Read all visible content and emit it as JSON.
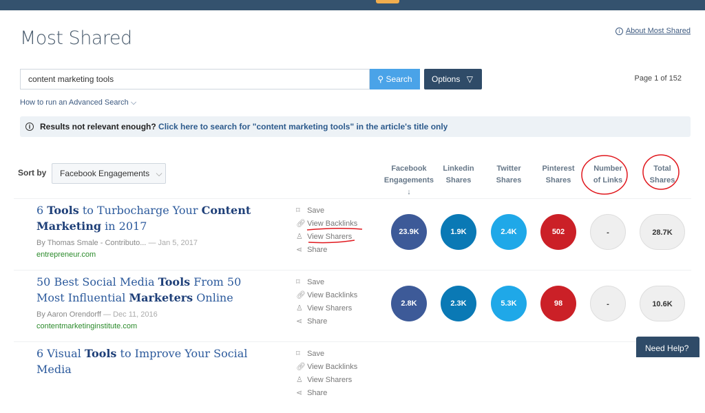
{
  "header": {
    "title": "Most Shared",
    "about_link": "About Most Shared"
  },
  "search": {
    "value": "content marketing tools",
    "button": "Search",
    "options": "Options",
    "page": "Page 1 of 152",
    "advanced": "How to run an Advanced Search"
  },
  "banner": {
    "prefix": "Results not relevant enough?",
    "link": "Click here to search for \"content marketing tools\" in the article's title only"
  },
  "sort": {
    "label": "Sort by",
    "value": "Facebook Engagements"
  },
  "columns": [
    {
      "line1": "Facebook",
      "line2": "Engagements ↓"
    },
    {
      "line1": "Linkedin",
      "line2": "Shares"
    },
    {
      "line1": "Twitter",
      "line2": "Shares"
    },
    {
      "line1": "Pinterest",
      "line2": "Shares"
    },
    {
      "line1": "Number",
      "line2": "of Links"
    },
    {
      "line1": "Total",
      "line2": "Shares"
    }
  ],
  "actions": {
    "save": "Save",
    "backlinks": "View Backlinks",
    "sharers": "View Sharers",
    "share": "Share"
  },
  "colors": {
    "facebook": "#3d5a98",
    "linkedin": "#0a79b5",
    "twitter": "#1fa8e8",
    "pinterest": "#cb2027",
    "annotation": "#e0161c"
  },
  "results": [
    {
      "title_parts": [
        {
          "t": "6 ",
          "b": false
        },
        {
          "t": "Tools",
          "b": true
        },
        {
          "t": " to Turbocharge Your ",
          "b": false
        },
        {
          "t": "Content Marketing",
          "b": true
        },
        {
          "t": " in 2017",
          "b": false
        }
      ],
      "author": "By Thomas Smale - Contributo...",
      "date": "— Jan 5, 2017",
      "domain": "entrepreneur.com",
      "facebook": "23.9K",
      "linkedin": "1.9K",
      "twitter": "2.4K",
      "pinterest": "502",
      "links": "-",
      "total": "28.7K"
    },
    {
      "title_parts": [
        {
          "t": "50 Best Social Media ",
          "b": false
        },
        {
          "t": "Tools",
          "b": true
        },
        {
          "t": " From 50 Most Influential ",
          "b": false
        },
        {
          "t": "Marketers",
          "b": true
        },
        {
          "t": " Online",
          "b": false
        }
      ],
      "author": "By Aaron Orendorff",
      "date": "— Dec 11, 2016",
      "domain": "contentmarketinginstitute.com",
      "facebook": "2.8K",
      "linkedin": "2.3K",
      "twitter": "5.3K",
      "pinterest": "98",
      "links": "-",
      "total": "10.6K"
    },
    {
      "title_parts": [
        {
          "t": "6 Visual ",
          "b": false
        },
        {
          "t": "Tools",
          "b": true
        },
        {
          "t": " to Improve Your Social Media",
          "b": false
        }
      ],
      "author": "",
      "date": "",
      "domain": ""
    }
  ],
  "help": "Need Help?"
}
